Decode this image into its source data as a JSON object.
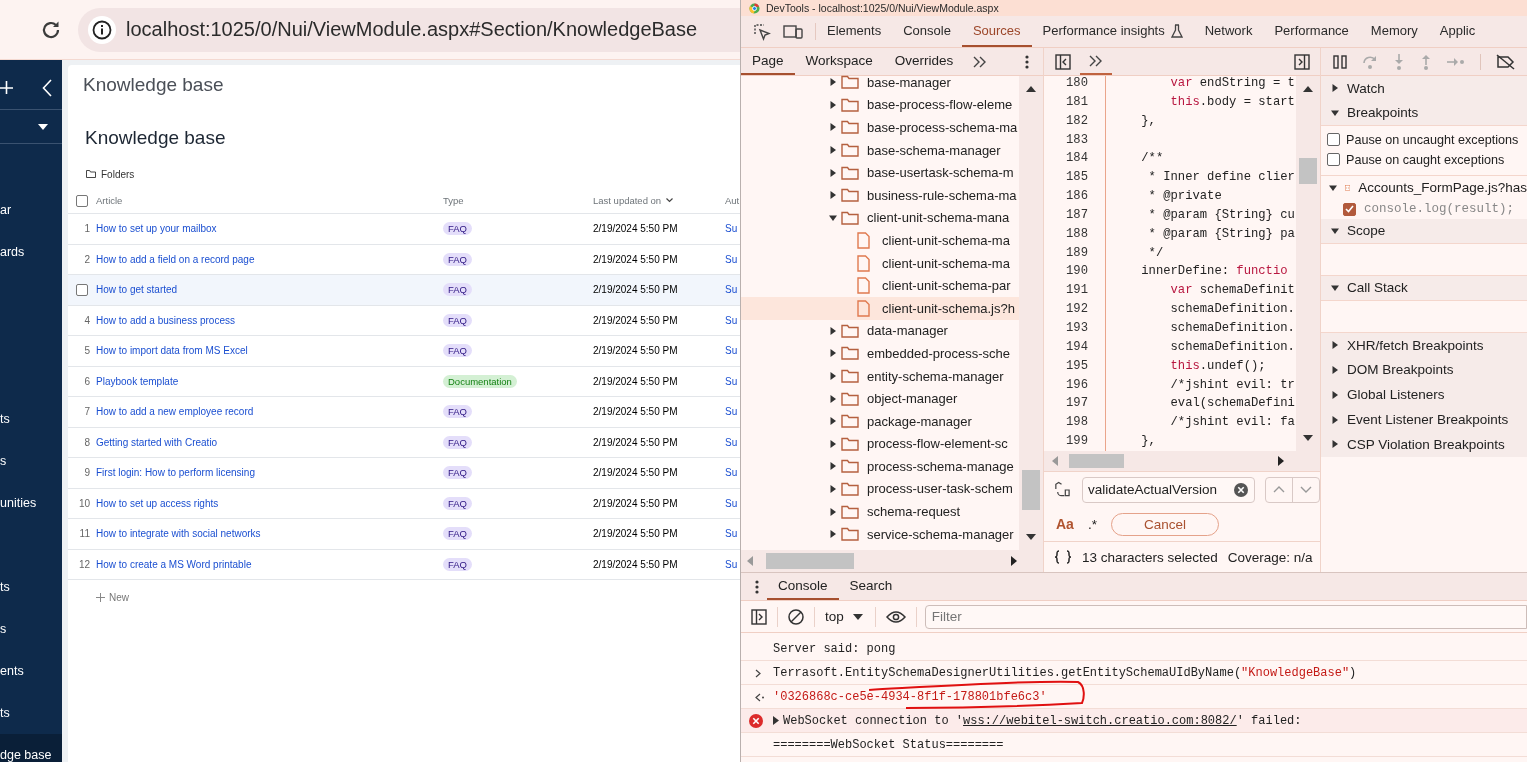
{
  "browser": {
    "url": "localhost:1025/0/Nui/ViewModule.aspx#Section/KnowledgeBase"
  },
  "nav": {
    "items": [
      {
        "label": "ar",
        "selected": false
      },
      {
        "label": "ards",
        "selected": false
      },
      {
        "label": "ts",
        "selected": false
      },
      {
        "label": "s",
        "selected": false
      },
      {
        "label": "unities",
        "selected": false
      },
      {
        "label": "ts",
        "selected": false
      },
      {
        "label": "s",
        "selected": false
      },
      {
        "label": "ents",
        "selected": false
      },
      {
        "label": "ts",
        "selected": false
      },
      {
        "label": "dge base",
        "selected": true
      }
    ]
  },
  "page": {
    "header": "Knowledge base",
    "title": "Knowledge base",
    "folders_button": "Folders",
    "table": {
      "select_all_checked": false,
      "columns": [
        {
          "label": "Article",
          "sorted": false
        },
        {
          "label": "Type",
          "sorted": false
        },
        {
          "label": "Last updated on",
          "sorted": true
        },
        {
          "label": "Aut",
          "sorted": false
        }
      ],
      "rows": [
        {
          "number": "1",
          "hovered": false,
          "article": "How to set up your mailbox",
          "type": {
            "label": "FAQ",
            "color": "#e4defa"
          },
          "updated": "2/19/2024 5:50 PM",
          "author": "Su"
        },
        {
          "number": "2",
          "hovered": false,
          "article": "How to add a field on a record page",
          "type": {
            "label": "FAQ",
            "color": "#e4defa"
          },
          "updated": "2/19/2024 5:50 PM",
          "author": "Su"
        },
        {
          "hovered": true,
          "article": "How to get started",
          "type": {
            "label": "FAQ",
            "color": "#e4defa"
          },
          "updated": "2/19/2024 5:50 PM",
          "author": "Su"
        },
        {
          "number": "4",
          "hovered": false,
          "article": "How to add a business process",
          "type": {
            "label": "FAQ",
            "color": "#e4defa"
          },
          "updated": "2/19/2024 5:50 PM",
          "author": "Su"
        },
        {
          "number": "5",
          "hovered": false,
          "article": "How to import data from MS Excel",
          "type": {
            "label": "FAQ",
            "color": "#e4defa"
          },
          "updated": "2/19/2024 5:50 PM",
          "author": "Su"
        },
        {
          "number": "6",
          "hovered": false,
          "article": "Playbook template",
          "type": {
            "label": "Documentation",
            "color": "#d4f0d4"
          },
          "updated": "2/19/2024 5:50 PM",
          "author": "Su"
        },
        {
          "number": "7",
          "hovered": false,
          "article": "How to add a new employee record",
          "type": {
            "label": "FAQ",
            "color": "#e4defa"
          },
          "updated": "2/19/2024 5:50 PM",
          "author": "Su"
        },
        {
          "number": "8",
          "hovered": false,
          "article": "Getting started with Creatio",
          "type": {
            "label": "FAQ",
            "color": "#e4defa"
          },
          "updated": "2/19/2024 5:50 PM",
          "author": "Su"
        },
        {
          "number": "9",
          "hovered": false,
          "article": "First login: How to perform licensing",
          "type": {
            "label": "FAQ",
            "color": "#e4defa"
          },
          "updated": "2/19/2024 5:50 PM",
          "author": "Su"
        },
        {
          "number": "10",
          "hovered": false,
          "article": "How to set up access rights",
          "type": {
            "label": "FAQ",
            "color": "#e4defa"
          },
          "updated": "2/19/2024 5:50 PM",
          "author": "Su"
        },
        {
          "number": "11",
          "hovered": false,
          "article": "How to integrate with social networks",
          "type": {
            "label": "FAQ",
            "color": "#e4defa"
          },
          "updated": "2/19/2024 5:50 PM",
          "author": "Su"
        },
        {
          "number": "12",
          "hovered": false,
          "article": "How to create a MS Word printable",
          "type": {
            "label": "FAQ",
            "color": "#e4defa"
          },
          "updated": "2/19/2024 5:50 PM",
          "author": "Su"
        }
      ]
    },
    "new_button": "New"
  },
  "devtools": {
    "title": "DevTools - localhost:1025/0/Nui/ViewModule.aspx",
    "main_tabs": [
      {
        "label": "Elements",
        "selected": false,
        "experimental": false
      },
      {
        "label": "Console",
        "selected": false,
        "experimental": false
      },
      {
        "label": "Sources",
        "selected": true,
        "experimental": false
      },
      {
        "label": "Performance insights",
        "selected": false,
        "experimental": true
      },
      {
        "label": "Network",
        "selected": false,
        "experimental": false
      },
      {
        "label": "Performance",
        "selected": false,
        "experimental": false
      },
      {
        "label": "Memory",
        "selected": false,
        "experimental": false
      },
      {
        "label": "Applic",
        "selected": false,
        "experimental": false
      }
    ],
    "navigator": {
      "tabs": [
        {
          "label": "Page",
          "selected": true
        },
        {
          "label": "Workspace",
          "selected": false
        },
        {
          "label": "Overrides",
          "selected": false
        }
      ],
      "tree": [
        {
          "kind": "folder",
          "name": "base-manager",
          "expanded": false
        },
        {
          "kind": "folder",
          "name": "base-process-flow-eleme",
          "expanded": false
        },
        {
          "kind": "folder",
          "name": "base-process-schema-ma",
          "expanded": false
        },
        {
          "kind": "folder",
          "name": "base-schema-manager",
          "expanded": false
        },
        {
          "kind": "folder",
          "name": "base-usertask-schema-m",
          "expanded": false
        },
        {
          "kind": "folder",
          "name": "business-rule-schema-ma",
          "expanded": false
        },
        {
          "kind": "folder",
          "name": "client-unit-schema-mana",
          "expanded": true,
          "children": [
            {
              "kind": "file",
              "name": "client-unit-schema-ma",
              "selected": false
            },
            {
              "kind": "file",
              "name": "client-unit-schema-ma",
              "selected": false
            },
            {
              "kind": "file",
              "name": "client-unit-schema-par",
              "selected": false
            },
            {
              "kind": "file",
              "name": "client-unit-schema.js?h",
              "selected": true
            }
          ]
        },
        {
          "kind": "folder",
          "name": "data-manager",
          "expanded": false
        },
        {
          "kind": "folder",
          "name": "embedded-process-sche",
          "expanded": false
        },
        {
          "kind": "folder",
          "name": "entity-schema-manager",
          "expanded": false
        },
        {
          "kind": "folder",
          "name": "object-manager",
          "expanded": false
        },
        {
          "kind": "folder",
          "name": "package-manager",
          "expanded": false
        },
        {
          "kind": "folder",
          "name": "process-flow-element-sc",
          "expanded": false
        },
        {
          "kind": "folder",
          "name": "process-schema-manage",
          "expanded": false
        },
        {
          "kind": "folder",
          "name": "process-user-task-schem",
          "expanded": false
        },
        {
          "kind": "folder",
          "name": "schema-request",
          "expanded": false
        },
        {
          "kind": "folder",
          "name": "service-schema-manager",
          "expanded": false
        }
      ]
    },
    "editor": {
      "lines": [
        {
          "number": "180",
          "tokens": [
            {
              "text": "        var",
              "kind": "keyword"
            },
            {
              "text": " endString = t",
              "kind": "plain"
            }
          ]
        },
        {
          "number": "181",
          "tokens": [
            {
              "text": "        this",
              "kind": "keyword"
            },
            {
              "text": ".body = start",
              "kind": "plain"
            }
          ]
        },
        {
          "number": "182",
          "tokens": [
            {
              "text": "    },",
              "kind": "plain"
            }
          ]
        },
        {
          "number": "183"
        },
        {
          "number": "184",
          "tokens": [
            {
              "text": "    /**",
              "kind": "plain"
            }
          ]
        },
        {
          "number": "185",
          "tokens": [
            {
              "text": "     * Inner define clier",
              "kind": "plain"
            }
          ]
        },
        {
          "number": "186",
          "tokens": [
            {
              "text": "     * @private",
              "kind": "plain"
            }
          ]
        },
        {
          "number": "187",
          "tokens": [
            {
              "text": "     * @param {String} cu",
              "kind": "plain"
            }
          ]
        },
        {
          "number": "188",
          "tokens": [
            {
              "text": "     * @param {String} pa",
              "kind": "plain"
            }
          ]
        },
        {
          "number": "189",
          "tokens": [
            {
              "text": "     */",
              "kind": "plain"
            }
          ]
        },
        {
          "number": "190",
          "tokens": [
            {
              "text": "    innerDefine: ",
              "kind": "plain"
            },
            {
              "text": "functio",
              "kind": "keyword"
            }
          ]
        },
        {
          "number": "191",
          "tokens": [
            {
              "text": "        var",
              "kind": "keyword"
            },
            {
              "text": " schemaDefinit",
              "kind": "plain"
            }
          ]
        },
        {
          "number": "192",
          "tokens": [
            {
              "text": "        schemaDefinition.",
              "kind": "plain"
            }
          ]
        },
        {
          "number": "193",
          "tokens": [
            {
              "text": "        schemaDefinition.",
              "kind": "plain"
            }
          ]
        },
        {
          "number": "194",
          "tokens": [
            {
              "text": "        schemaDefinition.",
              "kind": "plain"
            }
          ]
        },
        {
          "number": "195",
          "tokens": [
            {
              "text": "        this",
              "kind": "keyword"
            },
            {
              "text": ".undef();",
              "kind": "plain"
            }
          ]
        },
        {
          "number": "196",
          "tokens": [
            {
              "text": "        /*jshint evil: tr",
              "kind": "plain"
            }
          ]
        },
        {
          "number": "197",
          "tokens": [
            {
              "text": "        eval(schemaDefini",
              "kind": "plain"
            }
          ]
        },
        {
          "number": "198",
          "tokens": [
            {
              "text": "        /*jshint evil: fa",
              "kind": "plain"
            }
          ]
        },
        {
          "number": "199",
          "tokens": [
            {
              "text": "    },",
              "kind": "plain"
            }
          ]
        }
      ],
      "search": {
        "value": "validateActualVersion"
      },
      "match_case": "Aa",
      "regex": ".*",
      "cancel": "Cancel",
      "status": "13 characters selected",
      "coverage": "Coverage: n/a"
    },
    "sidebar": {
      "sections": [
        {
          "title": "Watch",
          "expanded": false
        },
        {
          "title": "Breakpoints",
          "expanded": true,
          "options": [
            {
              "label": "Pause on uncaught exceptions",
              "checked": false
            },
            {
              "label": "Pause on caught exceptions",
              "checked": false
            }
          ],
          "files": [
            {
              "name": "Accounts_FormPage.js?has",
              "expanded": true,
              "breakpoints": [
                {
                  "code": "console.log(result);",
                  "checked": true
                }
              ]
            }
          ]
        },
        {
          "title": "Scope",
          "expanded": true
        },
        {
          "title": "Call Stack",
          "expanded": true
        },
        {
          "title": "XHR/fetch Breakpoints",
          "expanded": false
        },
        {
          "title": "DOM Breakpoints",
          "expanded": false
        },
        {
          "title": "Global Listeners",
          "expanded": false
        },
        {
          "title": "Event Listener Breakpoints",
          "expanded": false
        },
        {
          "title": "CSP Violation Breakpoints",
          "expanded": false
        }
      ]
    },
    "drawer": {
      "tabs": [
        {
          "label": "Console",
          "selected": true
        },
        {
          "label": "Search",
          "selected": false
        }
      ],
      "context": "top",
      "filter_placeholder": "Filter",
      "messages": [
        {
          "kind": "log",
          "text": "Server said: pong"
        },
        {
          "kind": "input",
          "tokens": [
            {
              "text": "Terrasoft.EntitySchemaDesignerUtilities.getEntitySchemaUIdByName(",
              "kind": "plain"
            },
            {
              "text": "\"KnowledgeBase\"",
              "kind": "string"
            },
            {
              "text": ")",
              "kind": "plain"
            }
          ]
        },
        {
          "kind": "result",
          "text": "'0326868c-ce5e-4934-8f1f-178801bfe6c3'"
        },
        {
          "kind": "error",
          "before": "WebSocket connection to '",
          "link": "wss://webitel-switch.creatio.com:8082/",
          "after": "' failed:"
        },
        {
          "kind": "log",
          "text": "========WebSocket Status========"
        }
      ]
    }
  }
}
